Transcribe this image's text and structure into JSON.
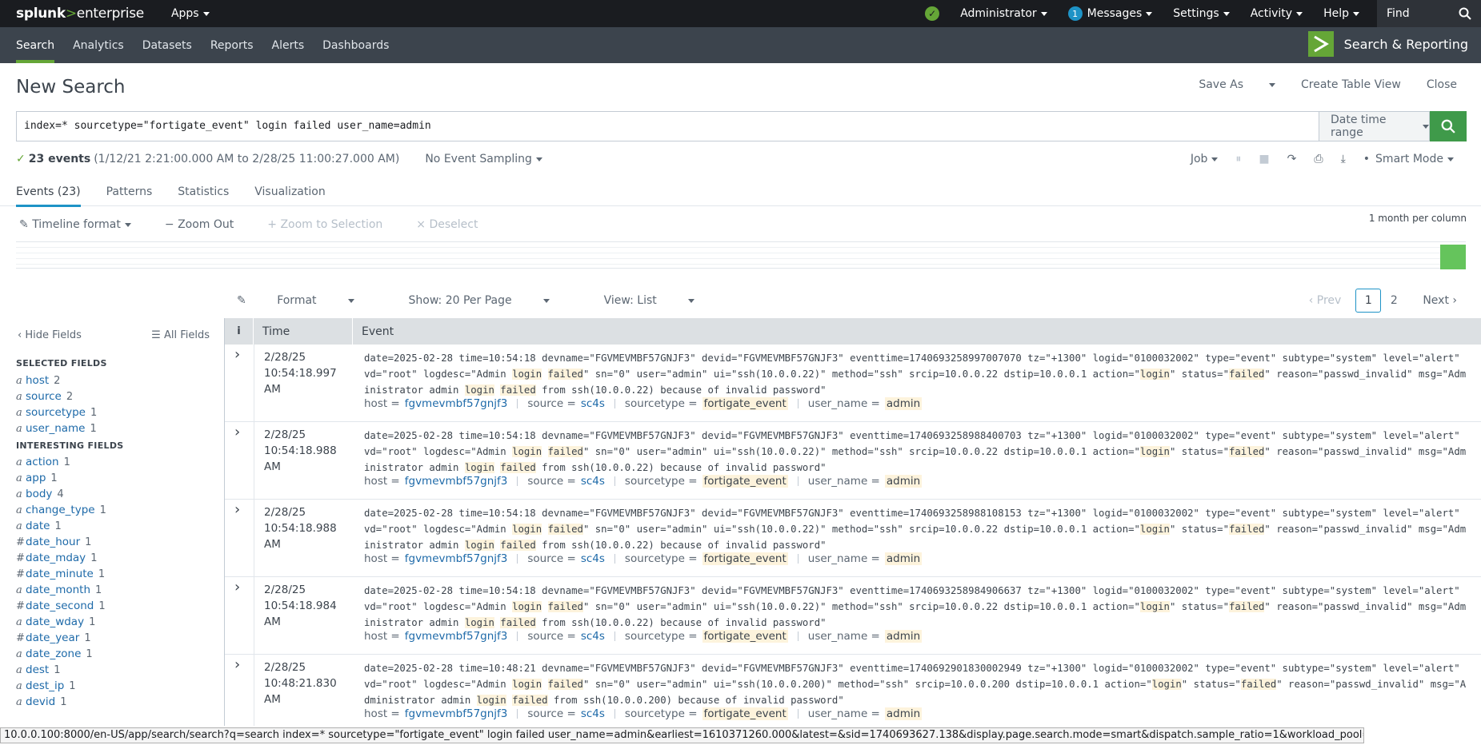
{
  "topbar": {
    "logo": {
      "brand": "splunk",
      "sep": ">",
      "product": "enterprise"
    },
    "apps": "Apps",
    "user": "Administrator",
    "messages_count": "1",
    "messages": "Messages",
    "settings": "Settings",
    "activity": "Activity",
    "help": "Help",
    "find": "Find"
  },
  "nav": {
    "items": [
      "Search",
      "Analytics",
      "Datasets",
      "Reports",
      "Alerts",
      "Dashboards"
    ],
    "app_title": "Search & Reporting"
  },
  "header": {
    "title": "New Search",
    "save_as": "Save As",
    "create_table": "Create Table View",
    "close": "Close"
  },
  "search": {
    "query": "index=* sourcetype=\"fortigate_event\" login failed user_name=admin",
    "date_range": "Date time range"
  },
  "status": {
    "count": "23 events",
    "range": "(1/12/21 2:21:00.000 AM to 2/28/25 11:00:27.000 AM)",
    "sampling": "No Event Sampling",
    "job": "Job",
    "mode": "Smart Mode"
  },
  "tabs": [
    "Events (23)",
    "Patterns",
    "Statistics",
    "Visualization"
  ],
  "timeline": {
    "format": "Timeline format",
    "zoom_out": "Zoom Out",
    "zoom_sel": "+ Zoom to Selection",
    "deselect": "Deselect",
    "scale": "1 month per column"
  },
  "results": {
    "format": "Format",
    "per_page": "Show: 20 Per Page",
    "view": "View: List",
    "prev": "Prev",
    "page1": "1",
    "page2": "2",
    "next": "Next"
  },
  "sidebar": {
    "hide": "Hide Fields",
    "all": "All Fields",
    "selected_heading": "SELECTED FIELDS",
    "selected": [
      {
        "t": "a",
        "n": "host",
        "c": "2"
      },
      {
        "t": "a",
        "n": "source",
        "c": "2"
      },
      {
        "t": "a",
        "n": "sourcetype",
        "c": "1"
      },
      {
        "t": "a",
        "n": "user_name",
        "c": "1"
      }
    ],
    "interesting_heading": "INTERESTING FIELDS",
    "interesting": [
      {
        "t": "a",
        "n": "action",
        "c": "1"
      },
      {
        "t": "a",
        "n": "app",
        "c": "1"
      },
      {
        "t": "a",
        "n": "body",
        "c": "4"
      },
      {
        "t": "a",
        "n": "change_type",
        "c": "1"
      },
      {
        "t": "a",
        "n": "date",
        "c": "1"
      },
      {
        "t": "#",
        "n": "date_hour",
        "c": "1"
      },
      {
        "t": "#",
        "n": "date_mday",
        "c": "1"
      },
      {
        "t": "#",
        "n": "date_minute",
        "c": "1"
      },
      {
        "t": "a",
        "n": "date_month",
        "c": "1"
      },
      {
        "t": "#",
        "n": "date_second",
        "c": "1"
      },
      {
        "t": "a",
        "n": "date_wday",
        "c": "1"
      },
      {
        "t": "#",
        "n": "date_year",
        "c": "1"
      },
      {
        "t": "a",
        "n": "date_zone",
        "c": "1"
      },
      {
        "t": "a",
        "n": "dest",
        "c": "1"
      },
      {
        "t": "a",
        "n": "dest_ip",
        "c": "1"
      },
      {
        "t": "a",
        "n": "devid",
        "c": "1"
      }
    ]
  },
  "table": {
    "col_i": "i",
    "col_time": "Time",
    "col_event": "Event",
    "events": [
      {
        "date": "2/28/25",
        "time": "10:54:18.997 AM",
        "eventtime": "1740693258997007070",
        "ip": "10.0.0.22",
        "dst": "10.0.0.1",
        "host": "fgvmevmbf57gnjf3",
        "source": "sc4s",
        "sourcetype": "fortigate_event",
        "user_name": "admin"
      },
      {
        "date": "2/28/25",
        "time": "10:54:18.988 AM",
        "eventtime": "1740693258988400703",
        "ip": "10.0.0.22",
        "dst": "10.0.0.1",
        "host": "fgvmevmbf57gnjf3",
        "source": "sc4s",
        "sourcetype": "fortigate_event",
        "user_name": "admin"
      },
      {
        "date": "2/28/25",
        "time": "10:54:18.988 AM",
        "eventtime": "1740693258988108153",
        "ip": "10.0.0.22",
        "dst": "10.0.0.1",
        "host": "fgvmevmbf57gnjf3",
        "source": "sc4s",
        "sourcetype": "fortigate_event",
        "user_name": "admin"
      },
      {
        "date": "2/28/25",
        "time": "10:54:18.984 AM",
        "eventtime": "1740693258984906637",
        "ip": "10.0.0.22",
        "dst": "10.0.0.1",
        "host": "fgvmevmbf57gnjf3",
        "source": "sc4s",
        "sourcetype": "fortigate_event",
        "user_name": "admin"
      },
      {
        "date": "2/28/25",
        "time": "10:48:21.830 AM",
        "eventtime": "1740692901830002949",
        "ip": "10.0.0.200",
        "dst": "10.0.0.1",
        "host": "fgvmevmbf57gnjf3",
        "source": "sc4s",
        "sourcetype": "fortigate_event",
        "user_name": "admin"
      }
    ],
    "event_parts": {
      "p1": "date=2025-02-28 time=",
      "p2": " devname=\"FGVMEVMBF57GNJF3\" devid=\"FGVMEVMBF57GNJF3\" eventtime=",
      "p3": " tz=\"+1300\" logid=\"0100032002\" type=\"event\" subtype=\"system\" level=\"alert\" vd=\"root\" logdesc=\"Admin ",
      "login": "login",
      "failed": "failed",
      "p4": "\" sn=\"0\" user=\"admin\" ui=\"ssh(",
      "p5": ")\" method=\"ssh\" srcip=",
      "p6": " dstip=",
      "p7": " action=\"",
      "p8": "\" status=\"",
      "p9": "\" reason=\"passwd_invalid\" msg=\"Administrator admin ",
      "p10": " from ssh(",
      "p11": ") because of invalid password\"",
      "times": [
        "10:54:18",
        "10:54:18",
        "10:54:18",
        "10:54:18",
        "10:48:21"
      ]
    },
    "meta_labels": {
      "host": "host =",
      "source": "source =",
      "sourcetype": "sourcetype =",
      "user_name": "user_name ="
    }
  },
  "statusbar": "10.0.0.100:8000/en-US/app/search/search?q=search index=* sourcetype=\"fortigate_event\" login failed user_name=admin&earliest=1610371260.000&latest=&sid=1740693627.138&display.page.search.mode=smart&dispatch.sample_ratio=1&workload_pool=#"
}
